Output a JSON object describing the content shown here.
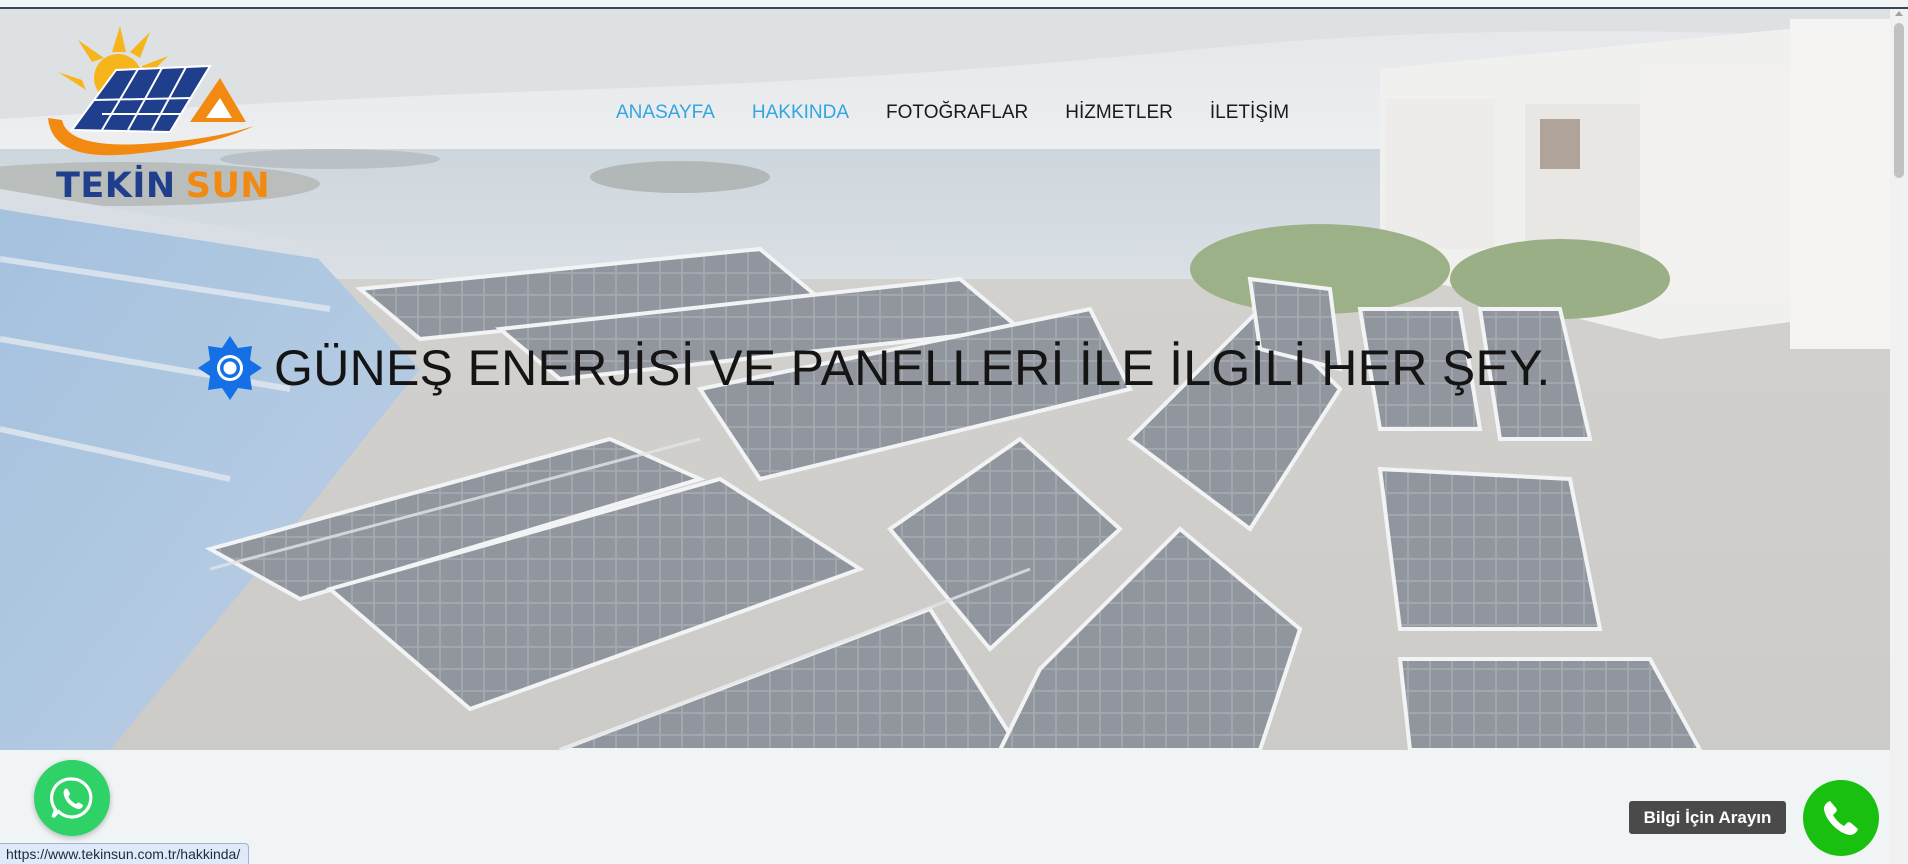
{
  "header": {
    "logo": {
      "word1": "TEKİN",
      "word2": "SUN",
      "color_primary": "#1f3f8c",
      "color_accent": "#f28a12",
      "sun_color": "#f7b51c"
    },
    "nav": [
      {
        "label": "ANASAYFA",
        "active": true
      },
      {
        "label": "HAKKINDA",
        "active": true
      },
      {
        "label": "FOTOĞRAFLAR",
        "active": false
      },
      {
        "label": "HİZMETLER",
        "active": false
      },
      {
        "label": "İLETİŞİM",
        "active": false
      }
    ],
    "nav_active_color": "#32a6e0"
  },
  "hero": {
    "headline_icon": "gear-sun-icon",
    "headline": "GÜNEŞ ENERJİSİ VE PANELLERİ İLE İLGİLİ HER ŞEY.",
    "background_image": "rooftop-solar-panels-sea-view"
  },
  "floating": {
    "whatsapp_icon": "whatsapp-icon",
    "whatsapp_color": "#2fd266",
    "call_label": "Bilgi İçin Arayın",
    "call_icon": "phone-icon",
    "call_color": "#19c010"
  },
  "status_bar": {
    "url": "https://www.tekinsun.com.tr/hakkinda/"
  }
}
